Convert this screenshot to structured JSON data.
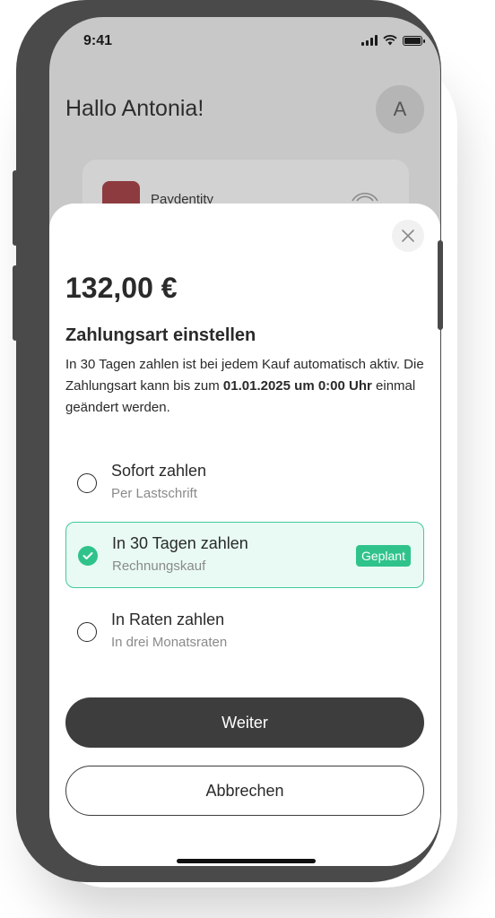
{
  "status_bar": {
    "time": "9:41"
  },
  "home": {
    "greeting": "Hallo Antonia!",
    "avatar_initial": "A",
    "card": {
      "name": "Paydentity"
    }
  },
  "sheet": {
    "amount": "132,00 €",
    "heading": "Zahlungsart einstellen",
    "description_part1": "In 30 Tagen zahlen ist bei jedem Kauf automatisch aktiv. Die Zahlungsart kann bis zum ",
    "description_bold": "01.01.2025 um 0:00 Uhr",
    "description_part2": " einmal geändert werden.",
    "options": [
      {
        "title": "Sofort zahlen",
        "subtitle": "Per Lastschrift",
        "selected": false
      },
      {
        "title": "In 30 Tagen zahlen",
        "subtitle": "Rechnungskauf",
        "selected": true,
        "badge": "Geplant"
      },
      {
        "title": "In Raten zahlen",
        "subtitle": "In drei Monatsraten",
        "selected": false
      }
    ],
    "primary_button": "Weiter",
    "secondary_button": "Abbrechen"
  },
  "colors": {
    "accent": "#2fc38b",
    "selected_bg": "#e8faf3",
    "button_dark": "#3d3d3d"
  }
}
